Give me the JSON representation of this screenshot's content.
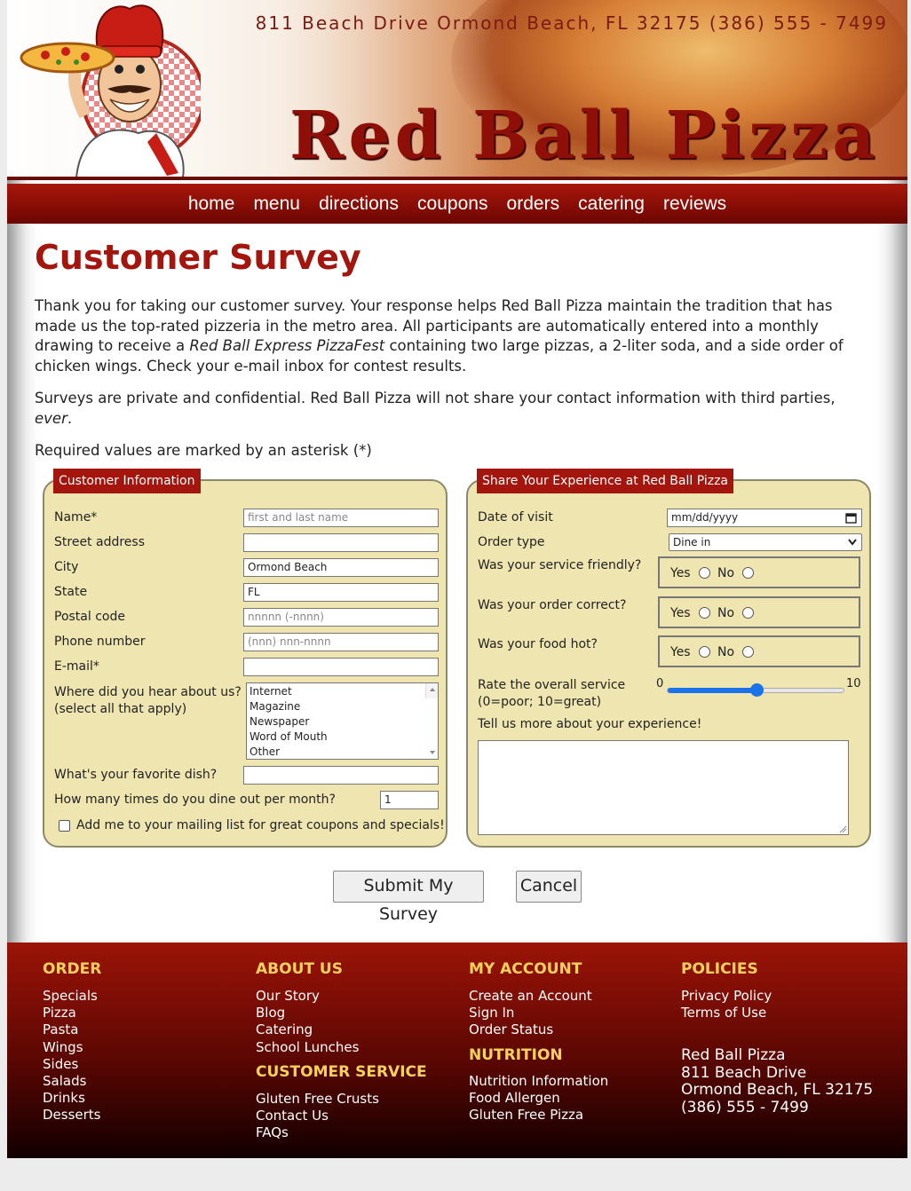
{
  "header": {
    "address": "811 Beach Drive  Ormond Beach, FL 32175   (386) 555 - 7499",
    "logo_text": "Red Ball Pizza"
  },
  "nav": [
    "home",
    "menu",
    "directions",
    "coupons",
    "orders",
    "catering",
    "reviews"
  ],
  "page": {
    "title": "Customer Survey",
    "intro_1_before": "Thank you for taking our customer survey. Your response helps Red Ball Pizza maintain the tradition that has made us the top-rated pizzeria in the metro area. All participants are automatically entered into a monthly drawing to receive a ",
    "intro_1_italic": "Red Ball Express PizzaFest",
    "intro_1_after": " containing two large pizzas, a 2-liter soda, and a side order of chicken wings. Check your e-mail inbox for contest results.",
    "intro_2_before": "Surveys are private and confidential. Red Ball Pizza will not share your contact information with third parties, ",
    "intro_2_italic": "ever",
    "intro_2_after": ".",
    "intro_3": "Required values are marked by an asterisk (*)"
  },
  "customer": {
    "legend": "Customer Information",
    "name_label": "Name*",
    "name_placeholder": "first and last name",
    "street_label": "Street address",
    "city_label": "City",
    "city_value": "Ormond Beach",
    "state_label": "State",
    "state_value": "FL",
    "postal_label": "Postal code",
    "postal_placeholder": "nnnnn (-nnnn)",
    "phone_label": "Phone number",
    "phone_placeholder": "(nnn) nnn-nnnn",
    "email_label": "E-mail*",
    "hear_label_1": "Where did you hear about us?",
    "hear_label_2": "(select all that apply)",
    "hear_options": [
      "Internet",
      "Magazine",
      "Newspaper",
      "Word of Mouth",
      "Other"
    ],
    "dish_label": "What's your favorite dish?",
    "dine_label": "How many times do you dine out per month?",
    "dine_value": "1",
    "mailing_label": "Add me to your mailing list for great coupons and specials!"
  },
  "experience": {
    "legend": "Share Your Experience at Red Ball Pizza",
    "date_label": "Date of visit",
    "date_value": "mm/dd/yyyy",
    "order_label": "Order type",
    "order_value": "Dine in",
    "q_friendly": "Was your service friendly?",
    "q_correct": "Was your order correct?",
    "q_hot": "Was your food hot?",
    "yes": "Yes",
    "no": "No",
    "rate_label_1": "Rate the overall service",
    "rate_label_2": "(0=poor; 10=great)",
    "rate_min": "0",
    "rate_max": "10",
    "rate_value": 5,
    "more_label": "Tell us more about your experience!"
  },
  "buttons": {
    "submit": "Submit My Survey",
    "cancel": "Cancel"
  },
  "footer": {
    "order": {
      "title": "ORDER",
      "items": [
        "Specials",
        "Pizza",
        "Pasta",
        "Wings",
        "Sides",
        "Salads",
        "Drinks",
        "Desserts"
      ]
    },
    "about": {
      "title": "ABOUT US",
      "items": [
        "Our Story",
        "Blog",
        "Catering",
        "School Lunches"
      ]
    },
    "service": {
      "title": "CUSTOMER SERVICE",
      "items": [
        "Gluten Free Crusts",
        "Contact Us",
        "FAQs"
      ]
    },
    "account": {
      "title": "MY ACCOUNT",
      "items": [
        "Create an Account",
        "Sign In",
        "Order Status"
      ]
    },
    "nutrition": {
      "title": "NUTRITION",
      "items": [
        "Nutrition Information",
        "Food Allergen",
        "Gluten Free Pizza"
      ]
    },
    "policies": {
      "title": "POLICIES",
      "items": [
        "Privacy Policy",
        "Terms of Use"
      ]
    },
    "address": [
      "Red Ball Pizza",
      "811 Beach Drive",
      "Ormond Beach, FL 32175",
      "(386) 555 - 7499"
    ]
  }
}
